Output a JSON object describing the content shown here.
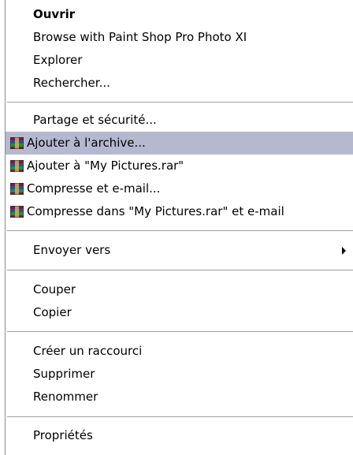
{
  "menu": {
    "group1": {
      "open": "Ouvrir",
      "browse_psp": "Browse with Paint Shop Pro Photo XI",
      "explore": "Explorer",
      "search": "Rechercher..."
    },
    "group2": {
      "share": "Partage et sécurité...",
      "add_archive": "Ajouter à l'archive...",
      "add_named": "Ajouter à \"My Pictures.rar\"",
      "compress_email": "Compresse et e-mail...",
      "compress_named_email": "Compresse dans \"My Pictures.rar\" et e-mail"
    },
    "group3": {
      "send_to": "Envoyer vers"
    },
    "group4": {
      "cut": "Couper",
      "copy": "Copier"
    },
    "group5": {
      "create_shortcut": "Créer un raccourci",
      "delete": "Supprimer",
      "rename": "Renommer"
    },
    "group6": {
      "properties": "Propriétés"
    }
  },
  "icons": {
    "rar": "winrar-archive-icon",
    "submenu": "submenu-arrow-icon"
  },
  "colors": {
    "highlight": "#b6b8cf",
    "separator": "#a0a0a0",
    "border": "#8a8a8a"
  }
}
